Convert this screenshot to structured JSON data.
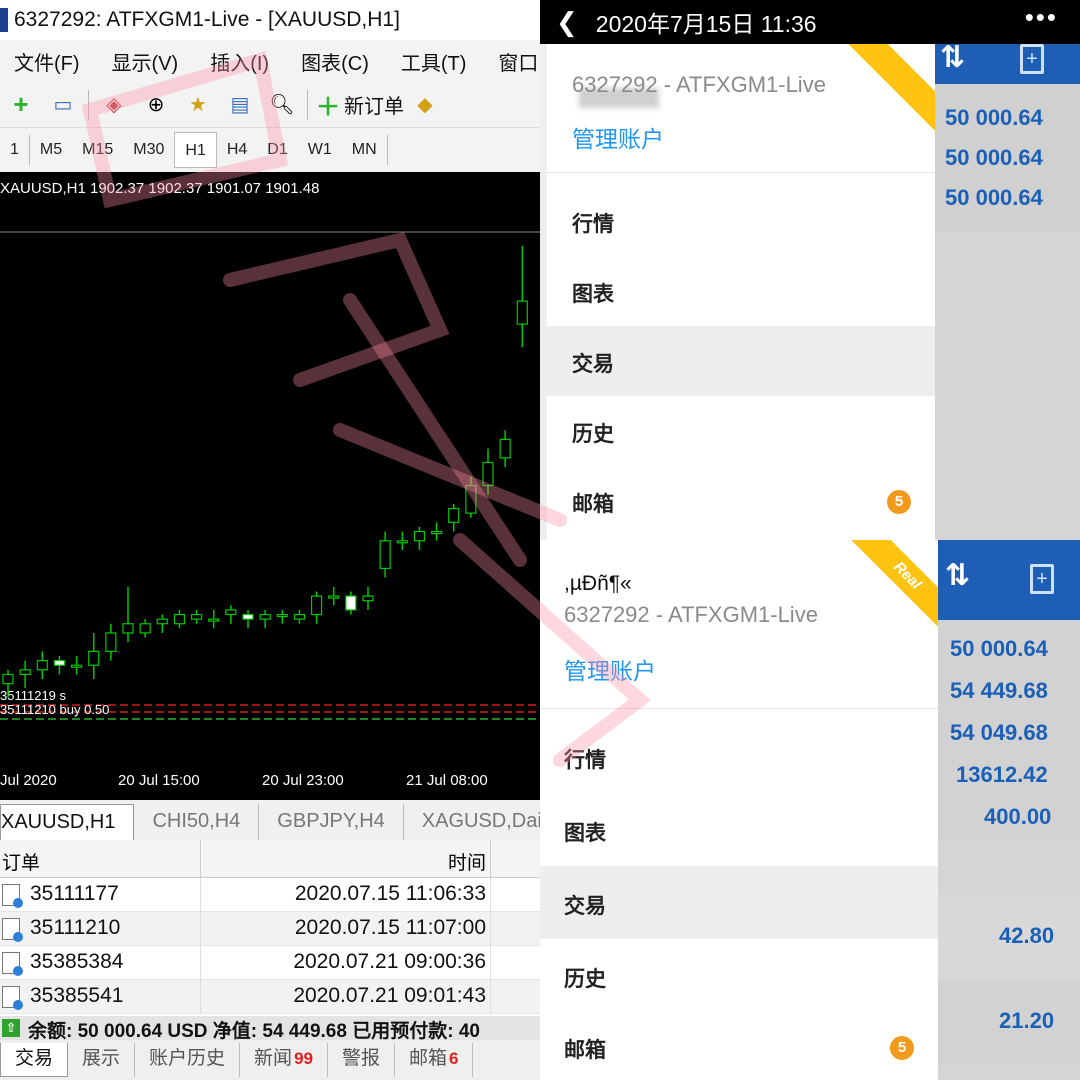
{
  "mt4": {
    "title": "6327292: ATFXGM1-Live - [XAUUSD,H1]",
    "menu": [
      "文件(F)",
      "显示(V)",
      "插入(I)",
      "图表(C)",
      "工具(T)",
      "窗口"
    ],
    "new_order_label": "新订单",
    "timeframes": [
      "1",
      "M5",
      "M15",
      "M30",
      "H1",
      "H4",
      "D1",
      "W1",
      "MN"
    ],
    "active_timeframe": "H1",
    "chart_header": "XAUUSD,H1  1902.37 1902.37 1901.07 1901.48",
    "chart_tabs": [
      "XAUUSD,H1",
      "CHI50,H4",
      "GBPJPY,H4",
      "XAGUSD,Dai"
    ],
    "order_labels": [
      "35111219 s",
      "35111210 buy 0.50"
    ],
    "terminal": {
      "col_order": "订单",
      "col_time": "时间",
      "rows": [
        {
          "order": "35111177",
          "time": "2020.07.15 11:06:33"
        },
        {
          "order": "35111210",
          "time": "2020.07.15 11:07:00"
        },
        {
          "order": "35385384",
          "time": "2020.07.21 09:00:36"
        },
        {
          "order": "35385541",
          "time": "2020.07.21 09:01:43"
        }
      ],
      "balance_line": "余额: 50 000.64 USD  净值: 54 449.68  已用预付款: 40"
    },
    "bottom_tabs": [
      {
        "label": "交易",
        "count": ""
      },
      {
        "label": "展示",
        "count": ""
      },
      {
        "label": "账户历史",
        "count": ""
      },
      {
        "label": "新闻",
        "count": "99"
      },
      {
        "label": "警报",
        "count": ""
      },
      {
        "label": "邮箱",
        "count": "6"
      }
    ]
  },
  "chart_data": {
    "type": "candlestick",
    "x_tick_labels": [
      "Jul 2020",
      "20 Jul 15:00",
      "20 Jul 23:00",
      "21 Jul 08:00"
    ],
    "bull_color": "#00c800",
    "bear_color": "#ffffff",
    "candles_note": "",
    "x": [
      0,
      1,
      2,
      3,
      4,
      5,
      6,
      7,
      8,
      9,
      10,
      11,
      12,
      13,
      14,
      15,
      16,
      17,
      18,
      19,
      20,
      21,
      22,
      23,
      24,
      25,
      26,
      27,
      28,
      29,
      30
    ],
    "open": [
      1807,
      1809,
      1810,
      1812,
      1811,
      1811,
      1814,
      1818,
      1818,
      1820,
      1820,
      1821,
      1821,
      1822,
      1822,
      1821,
      1822,
      1821,
      1822,
      1826,
      1826,
      1825,
      1832,
      1838,
      1838,
      1840,
      1842,
      1844,
      1850,
      1856,
      1885
    ],
    "close": [
      1809,
      1810,
      1812,
      1811,
      1811,
      1814,
      1818,
      1820,
      1820,
      1821,
      1822,
      1822,
      1821,
      1823,
      1821,
      1822,
      1822,
      1822,
      1826,
      1826,
      1823,
      1826,
      1838,
      1838,
      1840,
      1840,
      1845,
      1850,
      1855,
      1860,
      1890
    ],
    "high": [
      1810,
      1812,
      1814,
      1813,
      1813,
      1818,
      1820,
      1828,
      1821,
      1822,
      1823,
      1823,
      1823,
      1824,
      1823,
      1823,
      1823,
      1823,
      1827,
      1828,
      1827,
      1828,
      1840,
      1840,
      1841,
      1842,
      1846,
      1852,
      1858,
      1862,
      1902
    ],
    "low": [
      1804,
      1806,
      1808,
      1809,
      1809,
      1808,
      1812,
      1816,
      1817,
      1818,
      1819,
      1820,
      1819,
      1820,
      1819,
      1819,
      1820,
      1820,
      1820,
      1824,
      1822,
      1823,
      1830,
      1836,
      1836,
      1838,
      1840,
      1843,
      1848,
      1854,
      1880
    ],
    "ylim": [
      1790,
      1905
    ]
  },
  "mobile_top": {
    "status_time": "2020年7月15日 11:36",
    "account_id": "6327292 - ATFXGM1-Live",
    "manage_label": "管理账户",
    "nav": [
      "行情",
      "图表",
      "交易",
      "历史",
      "邮箱"
    ],
    "active_nav": "交易",
    "mail_badge": "5",
    "bg_values": [
      "50 000.64",
      "50 000.64",
      "50 000.64"
    ]
  },
  "mobile_bottom": {
    "account_name": ",µĐñ¶«",
    "account_id": "6327292 - ATFXGM1-Live",
    "manage_label": "管理账户",
    "real_badge": "Real",
    "nav": [
      "行情",
      "图表",
      "交易",
      "历史",
      "邮箱"
    ],
    "active_nav": "交易",
    "mail_badge": "5",
    "bg_values": [
      "50 000.64",
      "54 449.68",
      "54 049.68",
      "13612.42",
      "400.00",
      "42.80",
      "21.20"
    ]
  },
  "colors": {
    "mt4_chart_bg": "#000000",
    "mobile_blue": "#1f5eb5",
    "link_blue": "#2196f3",
    "badge_orange": "#f29a1b",
    "real_yellow": "#ffc312"
  }
}
